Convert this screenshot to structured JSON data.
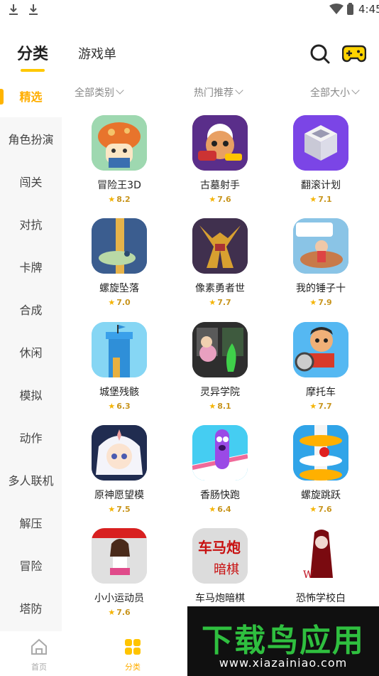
{
  "status_bar": {
    "time": "4:45"
  },
  "header": {
    "tab_category": "分类",
    "tab_gamelist": "游戏单"
  },
  "sidebar": {
    "items": [
      {
        "label": "精选",
        "active": true
      },
      {
        "label": "角色扮演"
      },
      {
        "label": "闯关"
      },
      {
        "label": "对抗"
      },
      {
        "label": "卡牌"
      },
      {
        "label": "合成"
      },
      {
        "label": "休闲"
      },
      {
        "label": "模拟"
      },
      {
        "label": "动作"
      },
      {
        "label": "多人联机"
      },
      {
        "label": "解压"
      },
      {
        "label": "冒险"
      },
      {
        "label": "塔防"
      }
    ]
  },
  "filters": {
    "category": "全部类别",
    "sort": "热门推荐",
    "size": "全部大小"
  },
  "games": [
    {
      "name": "冒险王3D",
      "rating": "8.2",
      "icon": "mushroom-hero-icon"
    },
    {
      "name": "古墓射手",
      "rating": "7.6",
      "icon": "tomb-shooter-icon"
    },
    {
      "name": "翻滚计划",
      "rating": "7.1",
      "icon": "rolling-cube-icon"
    },
    {
      "name": "螺旋坠落",
      "rating": "7.0",
      "icon": "helix-fall-icon"
    },
    {
      "name": "像素勇者世",
      "rating": "7.7",
      "icon": "pixel-hero-icon"
    },
    {
      "name": "我的锤子十",
      "rating": "7.9",
      "icon": "hammer-icon"
    },
    {
      "name": "城堡残骸",
      "rating": "6.3",
      "icon": "castle-icon"
    },
    {
      "name": "灵异学院",
      "rating": "8.1",
      "icon": "ghost-school-icon"
    },
    {
      "name": "摩托车",
      "rating": "7.7",
      "icon": "motorcycle-icon"
    },
    {
      "name": "原神愿望模",
      "rating": "7.5",
      "icon": "anime-girl-icon"
    },
    {
      "name": "香肠快跑",
      "rating": "6.4",
      "icon": "sausage-run-icon"
    },
    {
      "name": "螺旋跳跃",
      "rating": "7.6",
      "icon": "helix-jump-icon"
    },
    {
      "name": "小小运动员",
      "rating": "7.6",
      "icon": "little-athlete-icon"
    },
    {
      "name": "车马炮暗棋",
      "rating": "",
      "icon": "chess-icon"
    },
    {
      "name": "恐怖学校白",
      "rating": "",
      "icon": "horror-school-icon"
    }
  ],
  "bottom_nav": {
    "home": "首页",
    "category": "分类"
  },
  "watermark": {
    "title": "下载鸟应用",
    "url": "www.xiazainiao.com"
  },
  "colors": {
    "accent": "#ffc800",
    "active_text": "#ffae00",
    "star": "#f5b400"
  }
}
